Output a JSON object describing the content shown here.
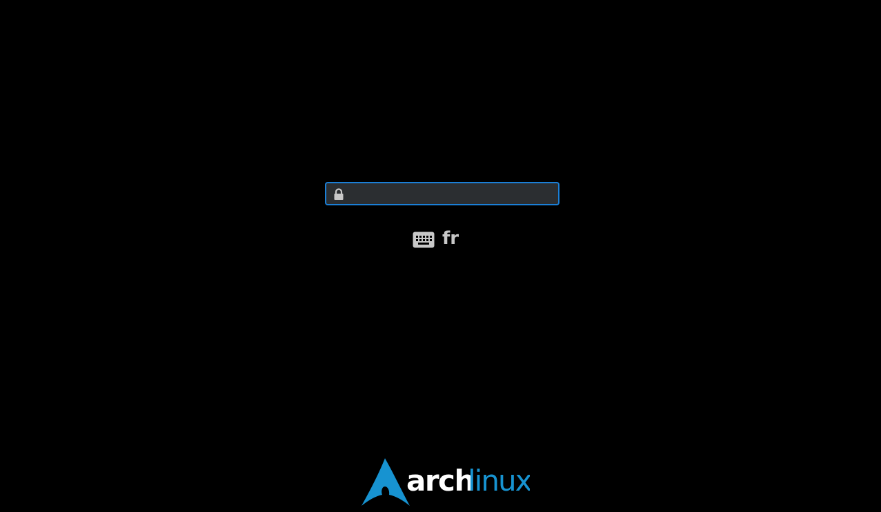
{
  "login": {
    "password_value": "",
    "keyboard_layout": "fr"
  },
  "branding": {
    "logo_text_bold": "arch",
    "logo_text_light": "linux",
    "trademark": "™"
  },
  "colors": {
    "background": "#000000",
    "field_background": "#2b2e31",
    "field_focus_border": "#1b7fd6",
    "icon_gray": "#c8c8c8",
    "arch_blue": "#1793d1",
    "arch_white": "#ffffff"
  },
  "icons": {
    "lock": "lock-icon",
    "keyboard": "keyboard-icon",
    "logo": "arch-linux-logo"
  }
}
